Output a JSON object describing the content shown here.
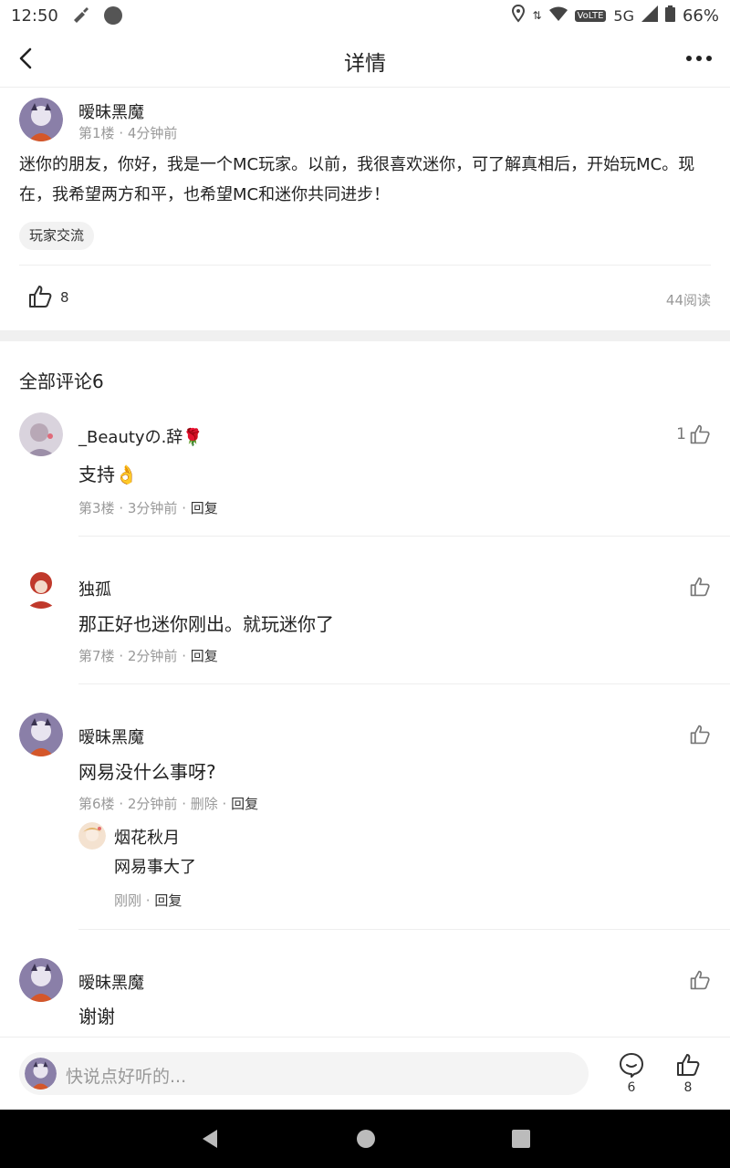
{
  "status_bar": {
    "time": "12:50",
    "network": "5G",
    "volte": "VoLTE",
    "battery": "66%"
  },
  "header": {
    "title": "详情"
  },
  "post": {
    "author": "暧昧黑魔",
    "floor": "第1楼",
    "time": "4分钟前",
    "content": "迷你的朋友，你好，我是一个MC玩家。以前，我很喜欢迷你，可了解真相后，开始玩MC。现在，我希望两方和平，也希望MC和迷你共同进步！",
    "tag": "玩家交流",
    "likes": "8",
    "reads": "44阅读"
  },
  "comments_section": {
    "title": "全部评论6"
  },
  "comments": [
    {
      "name": "_Beautyの.辞🌹",
      "text": "支持👌",
      "floor": "第3楼",
      "time": "3分钟前",
      "reply": "回复",
      "likes": "1"
    },
    {
      "name": "独孤",
      "text": "那正好也迷你刚出。就玩迷你了",
      "floor": "第7楼",
      "time": "2分钟前",
      "reply": "回复",
      "likes": ""
    },
    {
      "name": "暧昧黑魔",
      "text": "网易没什么事呀?",
      "floor": "第6楼",
      "time": "2分钟前",
      "delete": "删除",
      "reply": "回复",
      "likes": "",
      "sub_reply": {
        "name": "烟花秋月",
        "text": "网易事大了",
        "time": "刚刚",
        "reply": "回复"
      }
    },
    {
      "name": "暧昧黑魔",
      "text": "谢谢",
      "likes": ""
    }
  ],
  "input_bar": {
    "placeholder": "快说点好听的...",
    "comment_count": "6",
    "like_count": "8"
  },
  "colors": {
    "accent_gray": "#999999",
    "divider": "#eeeeee",
    "section_bg": "#f0f0f0"
  }
}
